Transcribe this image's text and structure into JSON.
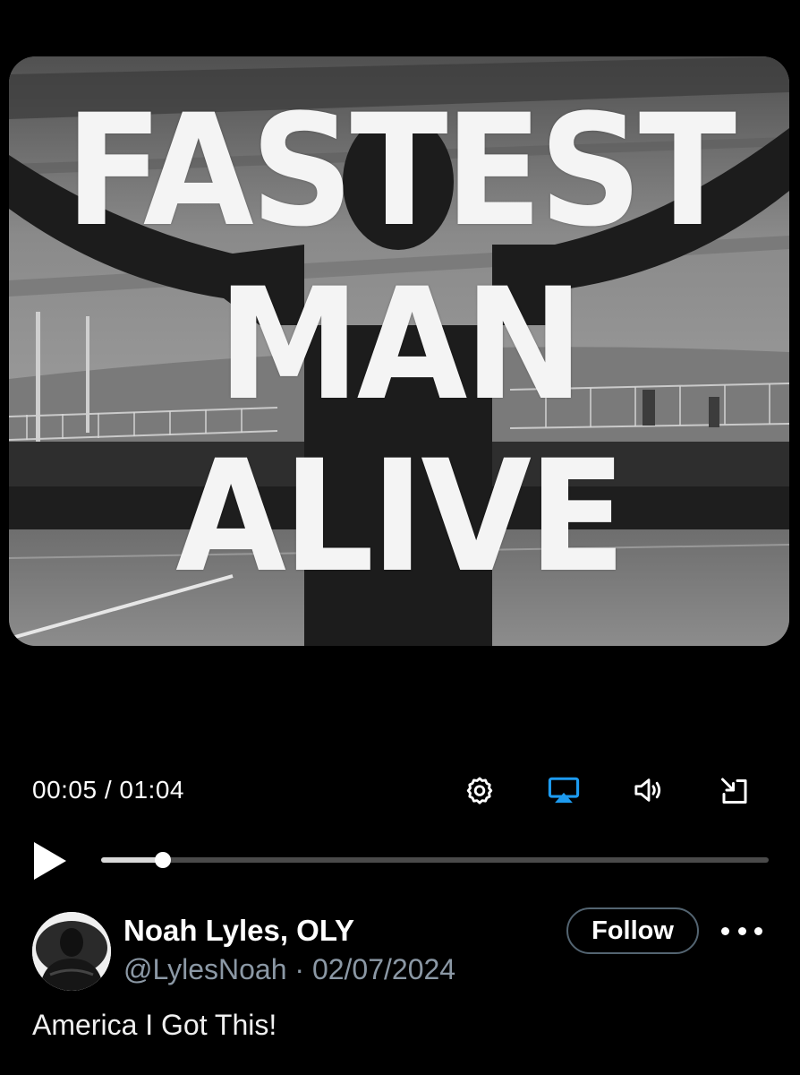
{
  "video": {
    "overlay_lines": [
      "FASTEST",
      "MAN",
      "ALIVE"
    ],
    "scene_description_icon": "stadium-figure-arms-spread-thumbnail"
  },
  "player": {
    "current_time": "00:05",
    "duration": "01:04",
    "time_readout": "00:05 / 01:04",
    "progress_fraction": 0.093,
    "icons": {
      "play": "play-icon",
      "settings": "gear-icon",
      "airplay": "airplay-icon",
      "volume": "volume-icon",
      "exit_fullscreen": "exit-fullscreen-icon"
    },
    "accent_color": "#1d9bf0"
  },
  "post": {
    "author_name": "Noah Lyles, OLY",
    "handle": "@LylesNoah",
    "separator": "·",
    "date": "02/07/2024",
    "meta_line": "@LylesNoah · 02/07/2024",
    "follow_label": "Follow",
    "more_icon": "more-horizontal-icon",
    "text": "America I Got This!"
  }
}
